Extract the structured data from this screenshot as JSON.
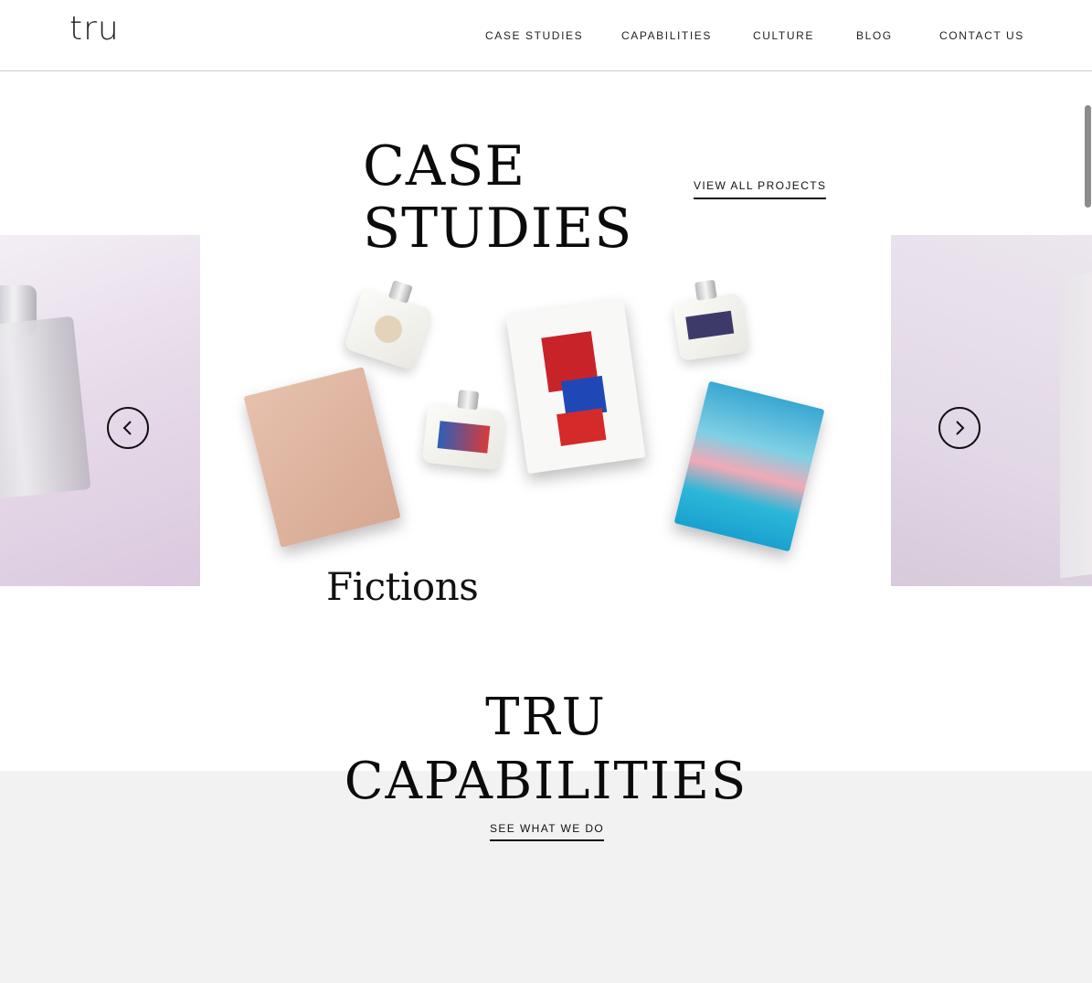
{
  "header": {
    "logo": "tru",
    "nav": [
      {
        "label": "CASE STUDIES"
      },
      {
        "label": "CAPABILITIES"
      },
      {
        "label": "CULTURE"
      },
      {
        "label": "BLOG"
      },
      {
        "label": "CONTACT US"
      }
    ]
  },
  "case_studies": {
    "title_line1": "CASE",
    "title_line2": "STUDIES",
    "view_all": "VIEW ALL PROJECTS",
    "current_project": "Fictions",
    "prev_icon": "chevron-left-icon",
    "next_icon": "chevron-right-icon"
  },
  "capabilities": {
    "title_line1": "TRU",
    "title_line2": "CAPABILITIES",
    "link": "SEE WHAT WE DO"
  }
}
